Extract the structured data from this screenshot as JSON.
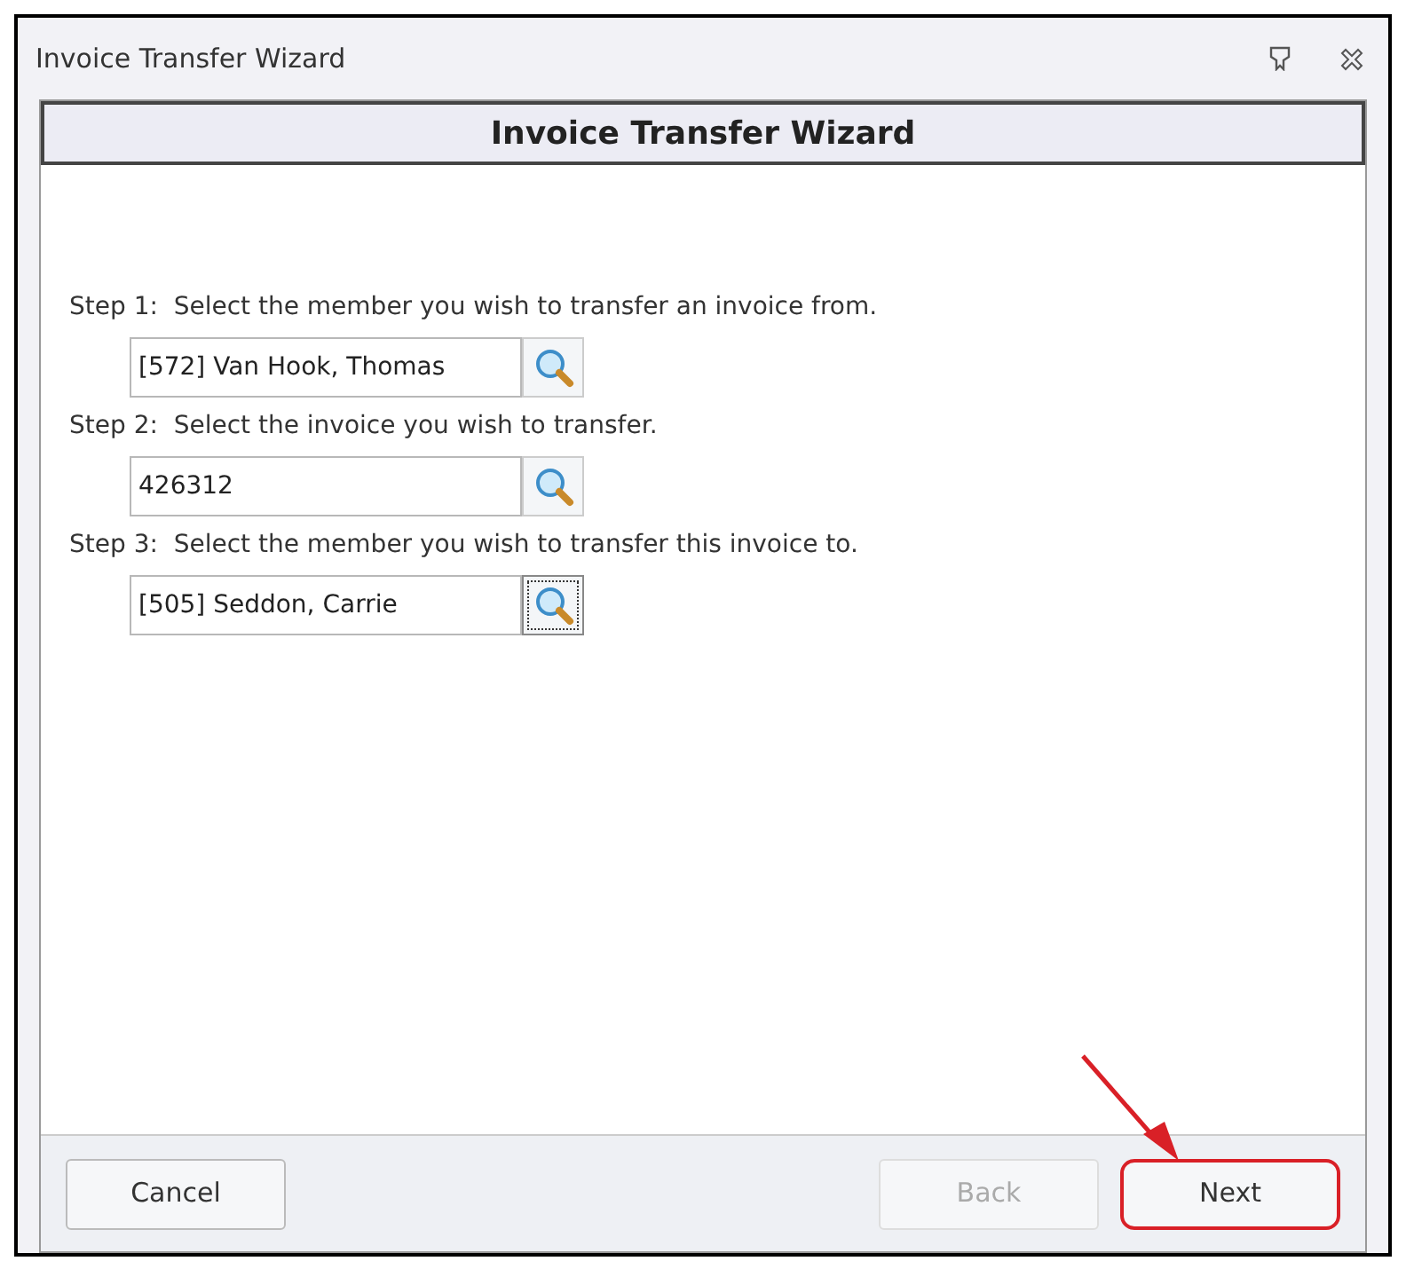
{
  "window": {
    "title": "Invoice Transfer Wizard"
  },
  "header": "Invoice Transfer Wizard",
  "steps": [
    {
      "label": "Step 1:  Select the member you wish to transfer an invoice from.",
      "value": "[572] Van Hook, Thomas",
      "focused": false
    },
    {
      "label": "Step 2:  Select the invoice you wish to transfer.",
      "value": "426312",
      "focused": false
    },
    {
      "label": "Step 3:  Select the member you wish to transfer this invoice to.",
      "value": "[505] Seddon, Carrie",
      "focused": true
    }
  ],
  "buttons": [
    {
      "label": "Cancel",
      "disabled": false,
      "highlighted": false
    },
    {
      "label": "Back",
      "disabled": true,
      "highlighted": false
    },
    {
      "label": "Next",
      "disabled": false,
      "highlighted": true
    }
  ]
}
